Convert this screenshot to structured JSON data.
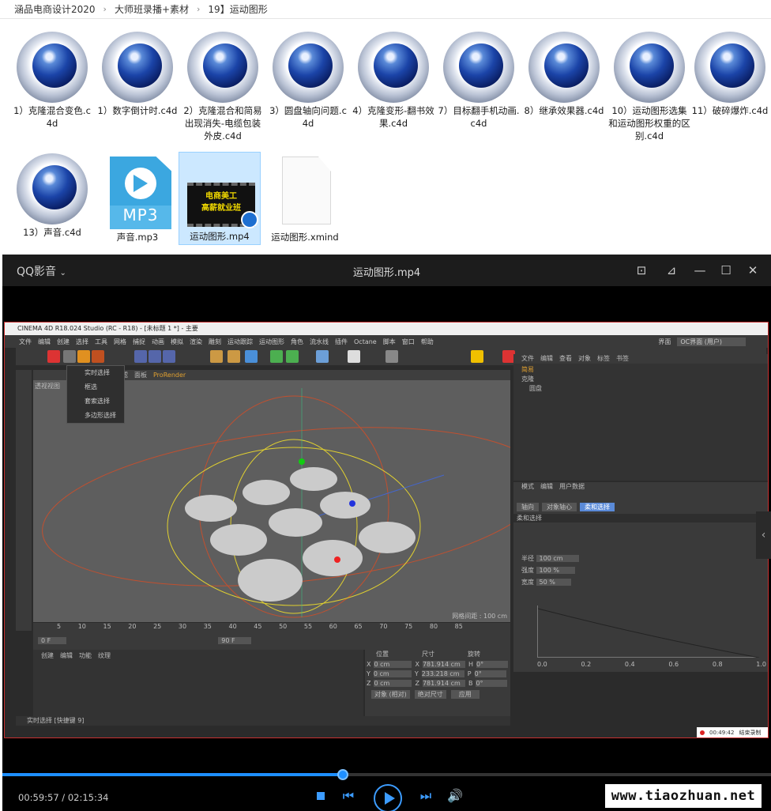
{
  "breadcrumb": {
    "items": [
      "涵品电商设计2020",
      "大师班录播+素材",
      "19】运动图形"
    ]
  },
  "files": [
    {
      "name": "1）克隆混合变色.c4d",
      "type": "c4d"
    },
    {
      "name": "1）数字倒计时.c4d",
      "type": "c4d"
    },
    {
      "name": "2）克隆混合和简易出现消失-电缆包装外皮.c4d",
      "type": "c4d"
    },
    {
      "name": "3）圆盘轴向问题.c4d",
      "type": "c4d"
    },
    {
      "name": "4）克隆变形-翻书效果.c4d",
      "type": "c4d"
    },
    {
      "name": "7）目标翻手机动画.c4d",
      "type": "c4d"
    },
    {
      "name": "8）继承效果器.c4d",
      "type": "c4d"
    },
    {
      "name": "10）运动图形选集和运动图形权重的区别.c4d",
      "type": "c4d"
    },
    {
      "name": "11）破碎爆炸.c4d",
      "type": "c4d"
    },
    {
      "name": "13）声音.c4d",
      "type": "c4d"
    },
    {
      "name": "声音.mp3",
      "type": "mp3",
      "badge": "MP3"
    },
    {
      "name": "运动图形.mp4",
      "type": "mp4",
      "thumb_line1": "电商美工",
      "thumb_line2": "高薪就业班"
    },
    {
      "name": "运动图形.xmind",
      "type": "xmind"
    }
  ],
  "player": {
    "app_name": "QQ影音",
    "title": "运动图形.mp4",
    "time_current": "00:59:57",
    "time_total": "02:15:34",
    "progress": 0.443,
    "watermark": "www.tiaozhuan.net",
    "accent": "#1e8fff"
  },
  "c4d": {
    "title": "CINEMA 4D R18.024 Studio (RC - R18) - [未标题 1 *] - 主要",
    "menu": [
      "文件",
      "编辑",
      "创建",
      "选择",
      "工具",
      "网格",
      "捕捉",
      "动画",
      "模拟",
      "渲染",
      "雕刻",
      "运动跟踪",
      "运动图形",
      "角色",
      "流水线",
      "插件",
      "Octane",
      "脚本",
      "窗口",
      "帮助"
    ],
    "layout_label": "界面",
    "layout_value": "OC界面 (用户)",
    "viewport_menu": [
      "查看",
      "摄像机",
      "显示",
      "选项",
      "过滤",
      "面板",
      "ProRender"
    ],
    "viewport_label": "透视视图",
    "grid_label": "网格间距 : 100 cm",
    "dropdown": [
      "实时选择",
      "框选",
      "套索选择",
      "多边形选择"
    ],
    "object_menu": [
      "文件",
      "编辑",
      "查看",
      "对象",
      "标签",
      "书签"
    ],
    "objects": [
      "简易",
      "克隆",
      "圆盘"
    ],
    "attr_menu": [
      "模式",
      "编辑",
      "用户数据"
    ],
    "attr_tabs": [
      "轴向",
      "对象轴心",
      "柔和选择"
    ],
    "attr_title": "柔和选择",
    "attr_fields": [
      {
        "label": "半径",
        "value": "100 cm"
      },
      {
        "label": "强度",
        "value": "100 %"
      },
      {
        "label": "宽度",
        "value": "50 %"
      }
    ],
    "ruler": [
      "0",
      "5",
      "10",
      "15",
      "20",
      "25",
      "30",
      "35",
      "40",
      "45",
      "50",
      "55",
      "60",
      "65",
      "70",
      "75",
      "80",
      "85",
      "90"
    ],
    "frame_start": "0 F",
    "frame_end": "90 F",
    "mat_menu": [
      "创建",
      "编辑",
      "功能",
      "纹理"
    ],
    "coord_headers": [
      "位置",
      "尺寸",
      "旋转"
    ],
    "coords": [
      {
        "axis": "X",
        "pos": "0 cm",
        "size": "781.914 cm",
        "rot_axis": "H",
        "rot": "0°"
      },
      {
        "axis": "Y",
        "pos": "0 cm",
        "size": "233.218 cm",
        "rot_axis": "P",
        "rot": "0°"
      },
      {
        "axis": "Z",
        "pos": "0 cm",
        "size": "781.914 cm",
        "rot_axis": "B",
        "rot": "0°"
      }
    ],
    "coord_mode": "对象 (相对)",
    "coord_size_mode": "绝对尺寸",
    "apply": "应用",
    "status": "实时选择 [快捷键 9]",
    "graph_x": [
      "0.0",
      "0.2",
      "0.4",
      "0.6",
      "0.8",
      "1.0"
    ],
    "rec_time": "00:49:42",
    "rec_label": "结束录制"
  }
}
